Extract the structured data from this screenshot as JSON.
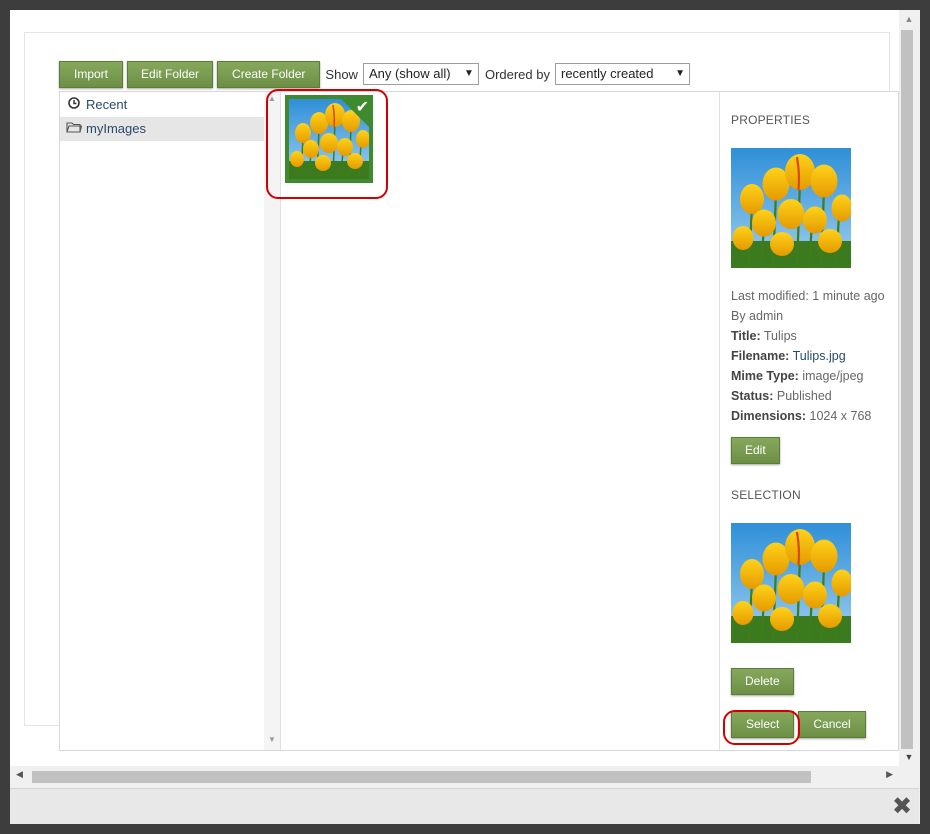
{
  "toolbar": {
    "import_label": "Import",
    "edit_folder_label": "Edit Folder",
    "create_folder_label": "Create Folder",
    "show_label": "Show",
    "show_value": "Any (show all)",
    "ordered_by_label": "Ordered by",
    "ordered_by_value": "recently created"
  },
  "tree": {
    "items": [
      {
        "label": "Recent",
        "icon": "clock-icon"
      },
      {
        "label": "myImages",
        "icon": "folder-icon"
      }
    ]
  },
  "properties": {
    "heading": "PROPERTIES",
    "last_modified": "Last modified: 1 minute ago",
    "by": "By admin",
    "title_label": "Title:",
    "title_value": "Tulips",
    "filename_label": "Filename:",
    "filename_value": "Tulips.jpg",
    "mime_label": "Mime Type:",
    "mime_value": "image/jpeg",
    "status_label": "Status:",
    "status_value": "Published",
    "dimensions_label": "Dimensions:",
    "dimensions_value": "1024 x 768",
    "edit_label": "Edit"
  },
  "selection": {
    "heading": "SELECTION",
    "delete_label": "Delete"
  },
  "actions": {
    "select_label": "Select",
    "cancel_label": "Cancel"
  },
  "colors": {
    "button_green": "#75984d",
    "selected_border": "#3f8a2e",
    "annotation_red": "#d40000"
  }
}
